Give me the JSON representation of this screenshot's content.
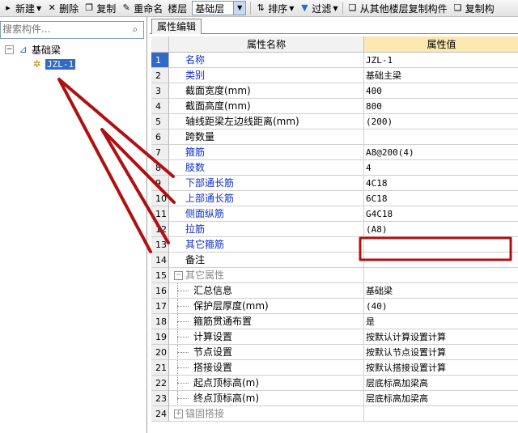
{
  "toolbar": {
    "new_label": "新建",
    "delete_label": "删除",
    "copy_label": "复制",
    "rename_label": "重命名",
    "floor_label": "楼层",
    "floor_value": "基础层",
    "sort_label": "排序",
    "filter_label": "过滤",
    "copy_from_floor_label": "从其他楼层复制构件",
    "copy_to_label": "复制构"
  },
  "search": {
    "placeholder": "搜索构件..."
  },
  "tree": {
    "root_label": "基础梁",
    "child_label": "JZL-1"
  },
  "tab": {
    "label": "属性编辑"
  },
  "grid": {
    "col_name": "属性名称",
    "col_value": "属性值",
    "rows": [
      {
        "num": "1",
        "name": "名称",
        "value": "JZL-1"
      },
      {
        "num": "2",
        "name": "类别",
        "value": "基础主梁"
      },
      {
        "num": "3",
        "name": "截面宽度(mm)",
        "value": "400"
      },
      {
        "num": "4",
        "name": "截面高度(mm)",
        "value": "800"
      },
      {
        "num": "5",
        "name": "轴线距梁左边线距离(mm)",
        "value": "(200)"
      },
      {
        "num": "6",
        "name": "跨数量",
        "value": ""
      },
      {
        "num": "7",
        "name": "箍筋",
        "value": "A8@200(4)"
      },
      {
        "num": "8",
        "name": "肢数",
        "value": "4"
      },
      {
        "num": "9",
        "name": "下部通长筋",
        "value": "4C18"
      },
      {
        "num": "10",
        "name": "上部通长筋",
        "value": "6C18"
      },
      {
        "num": "11",
        "name": "侧面纵筋",
        "value": "G4C18"
      },
      {
        "num": "12",
        "name": "拉筋",
        "value": "(A8)"
      },
      {
        "num": "13",
        "name": "其它箍筋",
        "value": ""
      },
      {
        "num": "14",
        "name": "备注",
        "value": ""
      },
      {
        "num": "15",
        "name": "其它属性",
        "value": ""
      },
      {
        "num": "16",
        "name": "汇总信息",
        "value": "基础梁"
      },
      {
        "num": "17",
        "name": "保护层厚度(mm)",
        "value": "(40)"
      },
      {
        "num": "18",
        "name": "箍筋贯通布置",
        "value": "是"
      },
      {
        "num": "19",
        "name": "计算设置",
        "value": "按默认计算设置计算"
      },
      {
        "num": "20",
        "name": "节点设置",
        "value": "按默认节点设置计算"
      },
      {
        "num": "21",
        "name": "搭接设置",
        "value": "按默认搭接设置计算"
      },
      {
        "num": "22",
        "name": "起点顶标高(m)",
        "value": "层底标高加梁高"
      },
      {
        "num": "23",
        "name": "终点顶标高(m)",
        "value": "层底标高加梁高"
      },
      {
        "num": "24",
        "name": "锚固搭接",
        "value": ""
      }
    ]
  },
  "colors": {
    "blue_text": "#1030d0",
    "annotation_red": "#b01010",
    "selection": "#316ac5",
    "value_header": "#fbe8b0"
  }
}
